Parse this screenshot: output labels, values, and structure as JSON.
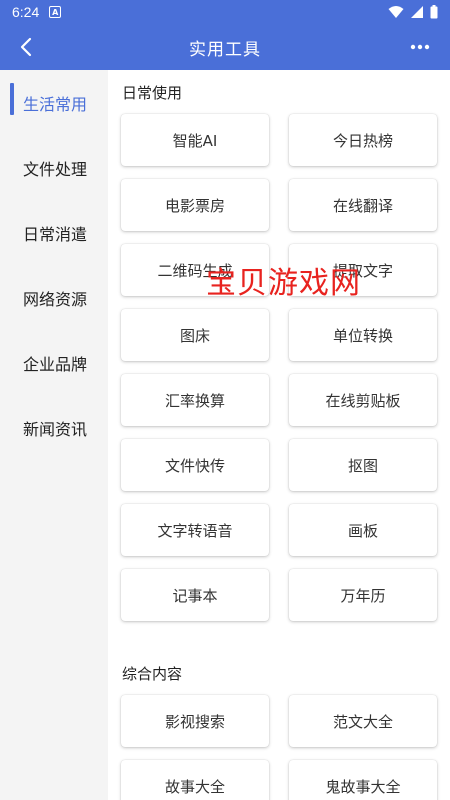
{
  "status": {
    "time": "6:24",
    "notif_icon": "a-badge-icon"
  },
  "header": {
    "title": "实用工具",
    "back_icon": "chevron-left-icon",
    "more_icon": "more-dots-icon"
  },
  "sidebar": {
    "items": [
      {
        "label": "生活常用",
        "active": true
      },
      {
        "label": "文件处理"
      },
      {
        "label": "日常消遣"
      },
      {
        "label": "网络资源"
      },
      {
        "label": "企业品牌"
      },
      {
        "label": "新闻资讯"
      }
    ]
  },
  "sections": [
    {
      "title": "日常使用",
      "tools": [
        "智能AI",
        "今日热榜",
        "电影票房",
        "在线翻译",
        "二维码生成",
        "提取文字",
        "图床",
        "单位转换",
        "汇率换算",
        "在线剪贴板",
        "文件快传",
        "抠图",
        "文字转语音",
        "画板",
        "记事本",
        "万年历"
      ]
    },
    {
      "title": "综合内容",
      "tools": [
        "影视搜索",
        "范文大全",
        "故事大全",
        "鬼故事大全"
      ]
    }
  ],
  "watermark": "宝贝游戏网",
  "colors": {
    "accent": "#4a6fd8",
    "watermark": "#e8231f"
  }
}
